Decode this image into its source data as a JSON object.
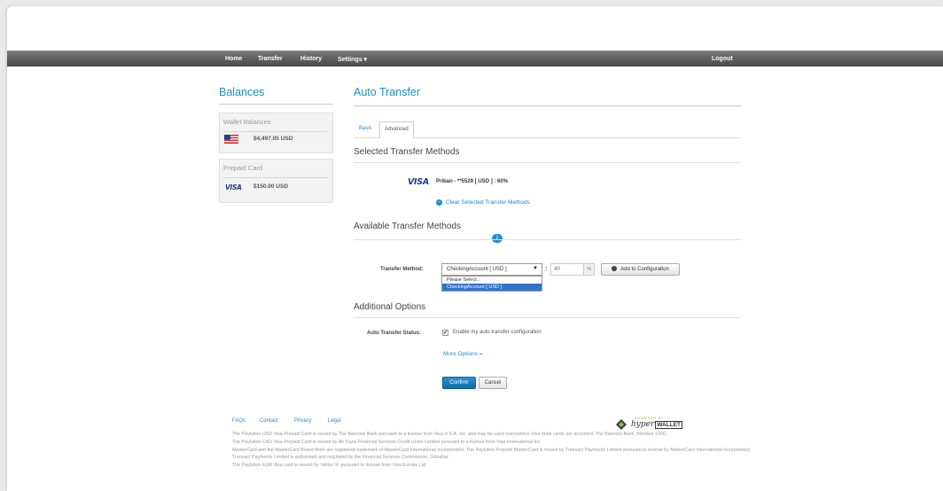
{
  "nav": {
    "home": "Home",
    "transfer": "Transfer",
    "history": "History",
    "settings": "Settings ▾",
    "logout": "Logout"
  },
  "sidebar": {
    "title": "Balances",
    "wallet": {
      "heading": "Wallet Balances",
      "amount": "$4,497.05 USD"
    },
    "prepaid": {
      "heading": "Prepaid Card",
      "card_brand": "VISA",
      "amount": "$150.00 USD"
    }
  },
  "main": {
    "title": "Auto Transfer",
    "tabs": [
      "Basic",
      "Advanced"
    ],
    "selected": {
      "title": "Selected Transfer Methods",
      "card_brand": "VISA",
      "item": "Priban - **5529 [ USD ] : 60%",
      "clear_link": "Clear Selected Transfer Methods"
    },
    "available": {
      "title": "Available Transfer Methods",
      "info_icon": "i",
      "method_label": "Transfer Method:",
      "select_value": "CheckingAccount [ USD ]",
      "options": [
        "Please Select...",
        "CheckingAccount [ USD ]"
      ],
      "separator": ":",
      "percent_value": "40",
      "percent_suffix": "%",
      "add_button": "Add to Configuration"
    },
    "additional": {
      "title": "Additional Options",
      "status_label": "Auto Transfer Status:",
      "checkbox_label": "Enable my auto transfer configuration",
      "more_options": "More Options »"
    },
    "confirm_button": "Confirm",
    "cancel_button": "Cancel"
  },
  "footer": {
    "links": [
      "FAQs",
      "Contact",
      "Privacy",
      "Legal"
    ],
    "powered_by": "POWERED BY",
    "brand_hyper": "hyper",
    "brand_wallet": "WALLET",
    "lines": [
      "The Paylution USD Visa Prepaid Card is issued by The Bancorp Bank pursuant to a license from Visa U.S.A. Inc. and may be used everywhere Visa debit cards are accepted. The Bancorp Bank; Member FDIC.",
      "The Paylution CAD Visa Prepaid Card is issued by All Trans Financial Services Credit Union Limited pursuant to a license from Visa International Inc.",
      "MasterCard and the MasterCard Brand Mark are registered trademark of MasterCard International Incorporated. The Paylution Prepaid MasterCard is issued by Transact Payments Limited pursuant to license by MasterCard International Incorporated. Transact Payments Limited is authorised and regulated by the Financial Services Commission, Gibraltar.",
      "The Paylution EUR Visa card is issued by Valitor hf. pursuant to license from Visa Europe Ltd."
    ]
  },
  "colors": {
    "accent": "#1a8fc9",
    "navbar": "#5d5d5d",
    "selected_option": "#3173c9",
    "primary_button": "#1279bb"
  }
}
